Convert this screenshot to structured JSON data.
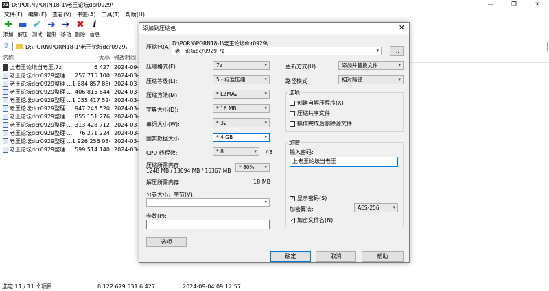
{
  "window": {
    "title": "D:\\PORN\\PORN18-1\\老王论坛dcr0929\\",
    "controls": [
      "—",
      "❐",
      "✕"
    ]
  },
  "menu": [
    "文件(F)",
    "编辑(E)",
    "查看(V)",
    "书签(A)",
    "工具(T)",
    "帮助(H)"
  ],
  "toolbar": [
    {
      "label": "添加",
      "icon": "add-icon",
      "glyph": "✚",
      "color": "#1aa01a"
    },
    {
      "label": "解压",
      "icon": "extract-icon",
      "glyph": "▬",
      "color": "#2a5bd7"
    },
    {
      "label": "测试",
      "icon": "test-icon",
      "glyph": "✔",
      "color": "#2ab0c0"
    },
    {
      "label": "复制",
      "icon": "copy-icon",
      "glyph": "➜",
      "color": "#2a5bd7"
    },
    {
      "label": "移动",
      "icon": "move-icon",
      "glyph": "➜",
      "color": "#1b3a8a"
    },
    {
      "label": "删除",
      "icon": "delete-icon",
      "glyph": "✖",
      "color": "#d01818"
    },
    {
      "label": "信息",
      "icon": "info-icon",
      "glyph": "i",
      "color": "#000000"
    }
  ],
  "address": "D:\\PORN\\PORN18-1\\老王论坛dcr0929\\",
  "list": {
    "headers": {
      "name": "名称",
      "size": "大小",
      "modified": "修改时间"
    },
    "rows": [
      {
        "name": "上老王论坛当老王.7z",
        "size": "6 427",
        "modified": "2024-09-0",
        "archive": true
      },
      {
        "name": "老王论坛dcr0929整理 ...",
        "size": "257 715 100",
        "modified": "2024-03-0"
      },
      {
        "name": "老王论坛dcr0929整理 ...",
        "size": "1 684 857 880",
        "modified": "2024-03-0"
      },
      {
        "name": "老王论坛dcr0929整理 ...",
        "size": "406 815 644",
        "modified": "2024-03-0"
      },
      {
        "name": "老王论坛dcr0929整理 ...",
        "size": "1 055 417 524",
        "modified": "2024-03-0"
      },
      {
        "name": "老王论坛dcr0929整理 ...",
        "size": "947 245 520",
        "modified": "2024-03-0"
      },
      {
        "name": "老王论坛dcr0929整理 ...",
        "size": "855 151 276",
        "modified": "2024-03-0"
      },
      {
        "name": "老王论坛dcr0929整理 ...",
        "size": "313 428 712",
        "modified": "2024-03-0"
      },
      {
        "name": "老王论坛dcr0929整理 ...",
        "size": "76 271 224",
        "modified": "2024-03-0"
      },
      {
        "name": "老王论坛dcr0929整理 ...",
        "size": "1 926 256 084",
        "modified": "2024-03-0"
      },
      {
        "name": "老王论坛dcr0929整理 ...",
        "size": "599 514 140",
        "modified": "2024-03-0"
      }
    ]
  },
  "status": {
    "selected": "选定 11 / 11 个项目",
    "total_size": "8 122 679 531",
    "sel_size": "6 427",
    "date": "2024-09-04 09:12:57"
  },
  "dialog": {
    "title": "添加到压缩包",
    "archive_label": "压缩包(A)",
    "archive_path": "D:\\PORN\\PORN18-1\\老王论坛dcr0929\\",
    "archive_name": "老王论坛dcr0929.7z",
    "browse_label": "...",
    "format_label": "压缩格式(F):",
    "format_value": "7z",
    "level_label": "压缩等级(L):",
    "level_value": "5 - 标准压缩",
    "method_label": "压缩方法(M):",
    "method_value": "* LZMA2",
    "dict_label": "字典大小(D):",
    "dict_value": "* 16 MB",
    "word_label": "单词大小(W):",
    "word_value": "* 32",
    "solid_label": "固实数据大小:",
    "solid_value": "* 4 GB",
    "threads_label": "CPU 线程数:",
    "threads_value": "* 8",
    "threads_max": "/ 8",
    "mem_label": "压缩所需内存:",
    "mem_detail": "1248 MB / 13094 MB / 16367 MB",
    "mem_pct": "* 80%",
    "decomp_label": "解压所需内存:",
    "decomp_value": "18 MB",
    "split_label": "分卷大小，字节(V):",
    "params_label": "参数(P):",
    "options_btn": "选项",
    "update_label": "更新方式(U):",
    "update_value": "添加并替换文件",
    "path_label": "路径模式",
    "path_value": "相对路径",
    "opt_group": "选项",
    "opt_sfx": "创建自解压程序(X)",
    "opt_shared": "压缩共享文件",
    "opt_delete": "操作完成后删除源文件",
    "enc_group": "加密",
    "pwd_label": "输入密码:",
    "pwd_value": "上老王论坛当老王",
    "show_pwd": "显示密码(S)",
    "enc_method_label": "加密算法:",
    "enc_method_value": "AES-256",
    "enc_names": "加密文件名(N)",
    "ok": "确定",
    "cancel": "取消",
    "help": "帮助"
  }
}
